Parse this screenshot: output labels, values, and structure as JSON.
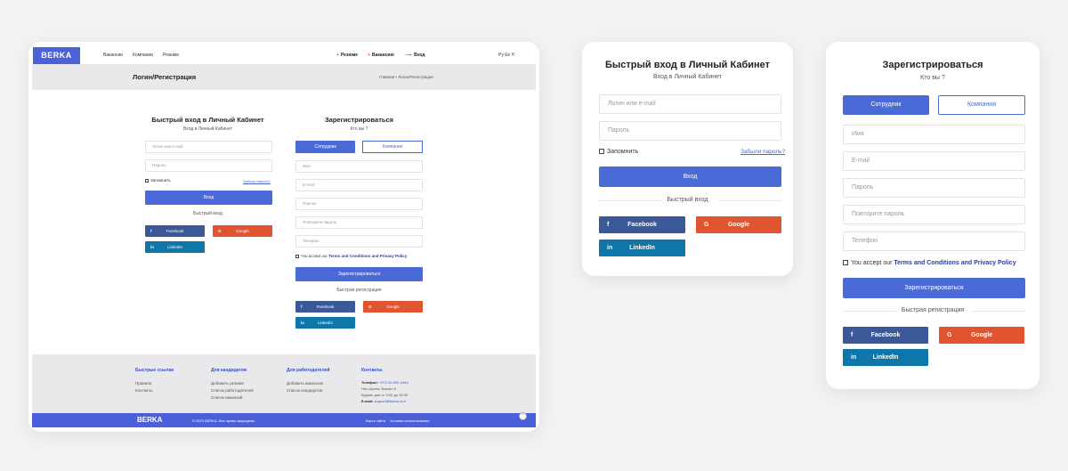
{
  "brand": "BERKA",
  "nav": {
    "links": [
      "Вакансии",
      "Компании",
      "Резюме"
    ],
    "actions": [
      {
        "label": "Резюме",
        "prefix": "+"
      },
      {
        "label": "Вакансию",
        "prefix": "+"
      },
      {
        "label": "Вход",
        "prefix": "⟶"
      }
    ],
    "lang": "Ру  En  ⇱"
  },
  "titlebar": {
    "title": "Логин/Регистрация",
    "breadcrumb": "Главная  •  Логин/Регистрация"
  },
  "login": {
    "title": "Быстрый вход в Личный Кабинет",
    "subtitle": "Вход в Личный Кабинет",
    "login_placeholder": "Логин или e-mail",
    "password_placeholder": "Пароль",
    "remember_label": "Запомнить",
    "forgot_link": "Забыли пароль?",
    "submit_label": "Вход",
    "quick_label": "Быстрый вход",
    "facebook_label": "Facebook",
    "google_label": "Google",
    "linkedin_label": "LinkedIn",
    "mini_submit_label": "Вход"
  },
  "register": {
    "title": "Зарегистрироваться",
    "subtitle": "Кто вы ?",
    "employee_label": "Сотрудник",
    "company_label": "Компания",
    "name_placeholder": "Имя",
    "email_placeholder": "E-mail",
    "password_placeholder": "Пароль",
    "repeat_placeholder": "Повторите пароль",
    "phone_placeholder": "Телефон",
    "terms_prefix": "You accept our",
    "terms_link": "Terms and Conditions and Privacy Policy",
    "submit_label": "Зарегистрироваться",
    "quick_label": "Быстрая регистрация",
    "facebook_label": "Facebook",
    "google_label": "Google",
    "linkedin_label": "LinkedIn"
  },
  "footer": {
    "quick": {
      "heading": "Быстрые ссылки",
      "items": [
        "Правила",
        "Контакты"
      ]
    },
    "candidates": {
      "heading": "Для кандидатов",
      "items": [
        "Добавить резюме",
        "Список работодателей",
        "Список вакансий"
      ]
    },
    "employers": {
      "heading": "Для работодателей",
      "items": [
        "Добавить вакансию",
        "Список кандидатов"
      ]
    },
    "contacts": {
      "heading": "Контакты",
      "phone_label": "Телефон:",
      "phone": "+972 00-902-4444",
      "address": "Нес-Циона, Вокзал 6",
      "hours": "Будние дни от 9:00 до 18:00",
      "email_label": "E-mail:",
      "email": "support@berka.co.il"
    }
  },
  "bottom": {
    "logo": "BERKA",
    "copyright": "© 2023 BERKA. Все права защищены.",
    "sitemap": "Карта сайта",
    "terms": "Условия использования"
  },
  "icons": {
    "facebook": "f",
    "google": "G",
    "linkedin": "in",
    "scroll_up": "⌃"
  },
  "colors": {
    "primary": "#4a6ad8",
    "facebook": "#3b5999",
    "google": "#e05530",
    "linkedin": "#0e76a8"
  }
}
